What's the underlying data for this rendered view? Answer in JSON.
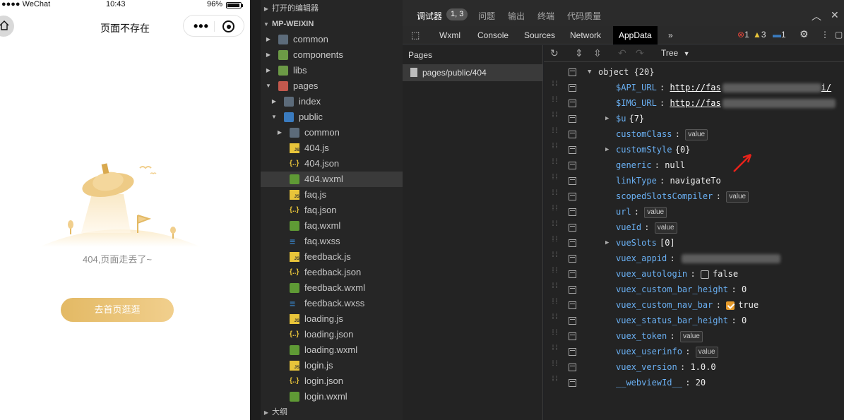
{
  "phone": {
    "status": {
      "carrier": "●●●● WeChat",
      "time": "10:43",
      "battery": "96%",
      "battery_level": 0.96
    },
    "nav": {
      "title": "页面不存在"
    },
    "page": {
      "message": "404,页面走丢了~",
      "home_button": "去首页逛逛"
    }
  },
  "explorer": {
    "open_editors": "打开的编辑器",
    "project": "MP-WEIXIN",
    "outline": "大纲",
    "items": [
      {
        "label": "common",
        "icon": "folder-icon"
      },
      {
        "label": "components",
        "icon": "folder-icon"
      },
      {
        "label": "libs",
        "icon": "folder-icon"
      },
      {
        "label": "pages",
        "icon": "folder-icon"
      },
      {
        "label": "index",
        "icon": "folder-icon"
      },
      {
        "label": "public",
        "icon": "folder-icon"
      },
      {
        "label": "common",
        "icon": "folder-icon"
      },
      {
        "label": "404.js",
        "icon": "js-file-icon"
      },
      {
        "label": "404.json",
        "icon": "json-file-icon"
      },
      {
        "label": "404.wxml",
        "icon": "wxml-file-icon"
      },
      {
        "label": "faq.js",
        "icon": "js-file-icon"
      },
      {
        "label": "faq.json",
        "icon": "json-file-icon"
      },
      {
        "label": "faq.wxml",
        "icon": "wxml-file-icon"
      },
      {
        "label": "faq.wxss",
        "icon": "wxss-file-icon"
      },
      {
        "label": "feedback.js",
        "icon": "js-file-icon"
      },
      {
        "label": "feedback.json",
        "icon": "json-file-icon"
      },
      {
        "label": "feedback.wxml",
        "icon": "wxml-file-icon"
      },
      {
        "label": "feedback.wxss",
        "icon": "wxss-file-icon"
      },
      {
        "label": "loading.js",
        "icon": "js-file-icon"
      },
      {
        "label": "loading.json",
        "icon": "json-file-icon"
      },
      {
        "label": "loading.wxml",
        "icon": "wxml-file-icon"
      },
      {
        "label": "login.js",
        "icon": "js-file-icon"
      },
      {
        "label": "login.json",
        "icon": "json-file-icon"
      },
      {
        "label": "login.wxml",
        "icon": "wxml-file-icon"
      }
    ]
  },
  "devtools": {
    "top_tabs": [
      "调试器",
      "问题",
      "输出",
      "终端",
      "代码质量"
    ],
    "debugger_badge": "1, 3",
    "tabs": [
      "Wxml",
      "Console",
      "Sources",
      "Network",
      "AppData"
    ],
    "active_tab": "AppData",
    "counts": {
      "errors": "1",
      "warnings": "3",
      "messages": "1"
    },
    "pages_title": "Pages",
    "page_path": "pages/public/404",
    "view_mode": "Tree",
    "root": "object {20}",
    "rows": [
      {
        "key": "$API_URL",
        "value": "http://fas",
        "suffix": "i/"
      },
      {
        "key": "$IMG_URL",
        "value": "http://fas"
      },
      {
        "key": "$u",
        "value": "{7}"
      },
      {
        "key": "customClass",
        "badge": "value"
      },
      {
        "key": "customStyle",
        "value": "{0}"
      },
      {
        "key": "generic",
        "value": "null"
      },
      {
        "key": "linkType",
        "value": "navigateTo"
      },
      {
        "key": "scopedSlotsCompiler",
        "badge": "value"
      },
      {
        "key": "url",
        "badge": "value"
      },
      {
        "key": "vueId",
        "badge": "value"
      },
      {
        "key": "vueSlots",
        "value": "[0]"
      },
      {
        "key": "vuex_appid"
      },
      {
        "key": "vuex_autologin",
        "value": "false"
      },
      {
        "key": "vuex_custom_bar_height",
        "value": "0"
      },
      {
        "key": "vuex_custom_nav_bar",
        "value": "true"
      },
      {
        "key": "vuex_status_bar_height",
        "value": "0"
      },
      {
        "key": "vuex_token",
        "badge": "value"
      },
      {
        "key": "vuex_userinfo",
        "badge": "value"
      },
      {
        "key": "vuex_version",
        "value": "1.0.0"
      },
      {
        "key": "__webviewId__",
        "value": "20"
      }
    ]
  },
  "colors": {
    "accent": "#e59a2a",
    "key": "#6ab0f3",
    "button_gradient_start": "#e3b964",
    "button_gradient_end": "#f1cf8d"
  }
}
